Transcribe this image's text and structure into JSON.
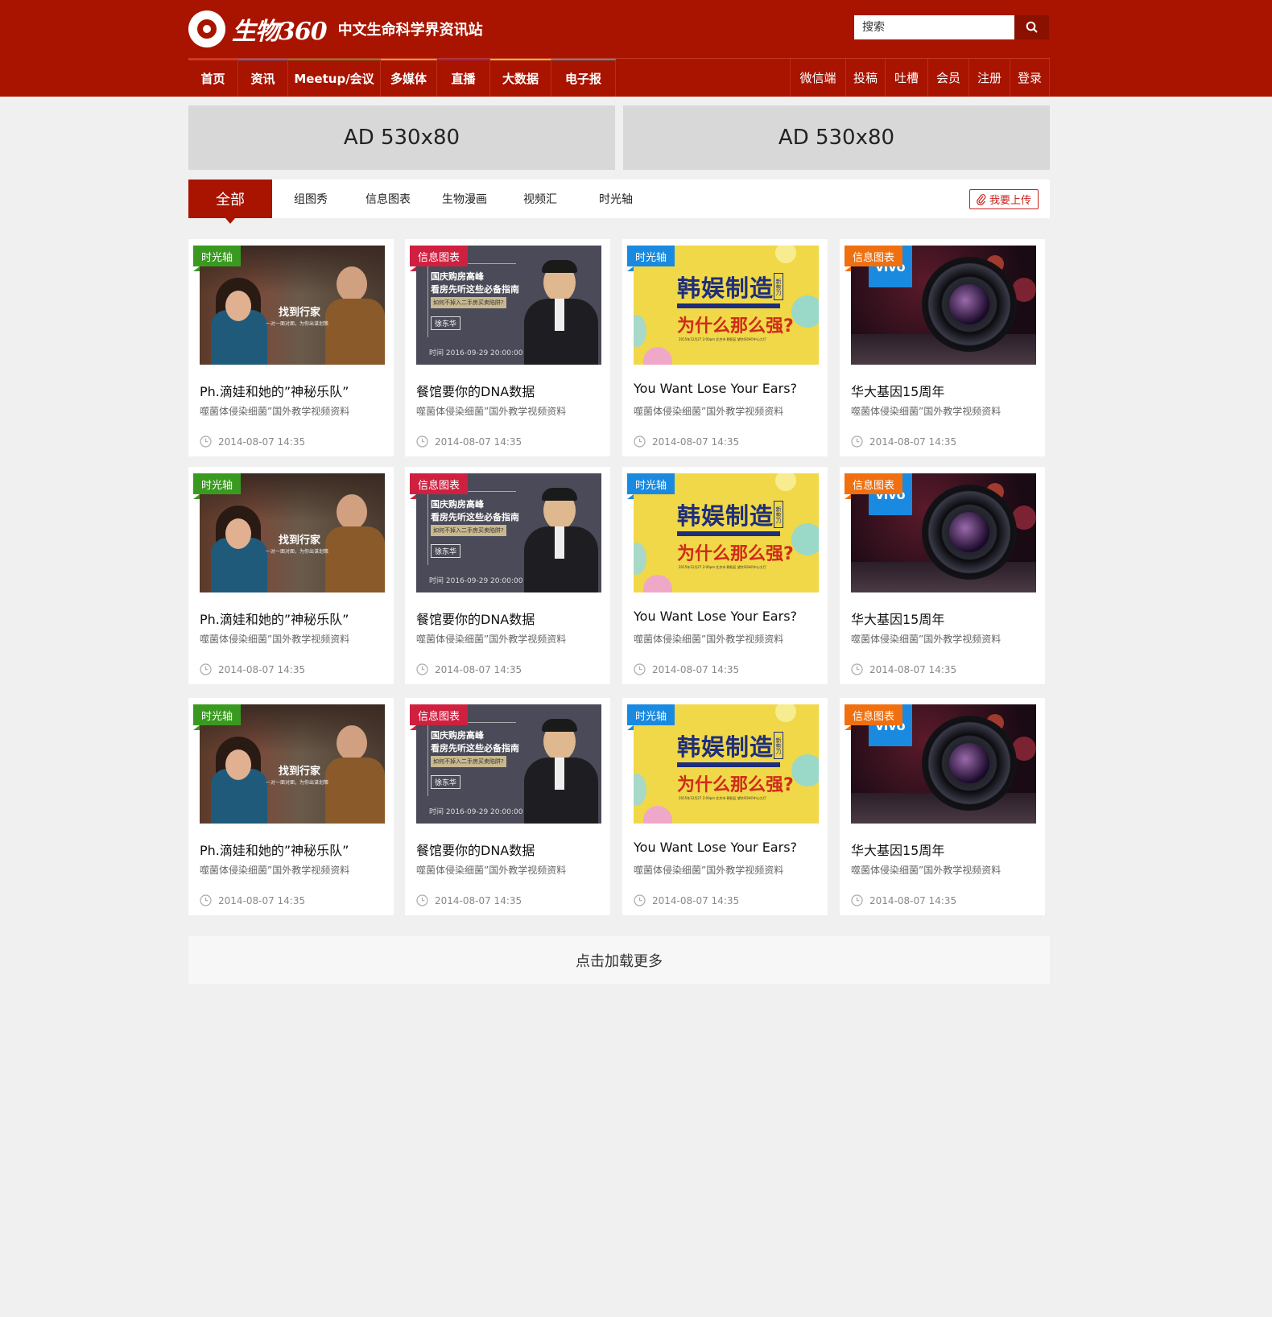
{
  "site": {
    "logo_text": "生物360",
    "slogan": "中文生命科学界资讯站"
  },
  "search": {
    "placeholder": "搜索"
  },
  "nav": {
    "left": [
      {
        "label": "首页",
        "accent": "#e83020"
      },
      {
        "label": "资讯",
        "accent": "#2a7de0"
      },
      {
        "label": "Meetup/会议",
        "accent": "#3aa040"
      },
      {
        "label": "多媒体",
        "accent": "#e8a020"
      },
      {
        "label": "直播",
        "accent": "#7a2aa0"
      },
      {
        "label": "大数据",
        "accent": "#e8c020"
      },
      {
        "label": "电子报",
        "accent": "#20a0c0"
      }
    ],
    "right": [
      {
        "label": "微信端"
      },
      {
        "label": "投稿"
      },
      {
        "label": "吐槽"
      },
      {
        "label": "会员"
      },
      {
        "label": "注册"
      },
      {
        "label": "登录"
      }
    ]
  },
  "ads": [
    {
      "label": "AD 530x80"
    },
    {
      "label": "AD 530x80"
    }
  ],
  "filter": {
    "tabs": [
      {
        "label": "全部"
      },
      {
        "label": "组图秀"
      },
      {
        "label": "信息图表"
      },
      {
        "label": "生物漫画"
      },
      {
        "label": "视频汇"
      },
      {
        "label": "时光轴"
      }
    ],
    "upload_label": "我要上传"
  },
  "card_types": [
    {
      "badge": "时光轴",
      "badge_color": "#3a9a20",
      "title": "Ph.滴娃和她的”神秘乐队”",
      "desc": "噬菌体侵染细菌”国外教学视频资料",
      "time": "2014-08-07 14:35",
      "thumb": {
        "caption": "找到行家",
        "subcaption": "一对一面对面，为你出谋划策"
      }
    },
    {
      "badge": "信息图表",
      "badge_color": "#d02040",
      "title": "餐馆要你的DNA数据",
      "desc": "噬菌体侵染细菌”国外教学视频资料",
      "time": "2014-08-07 14:35",
      "thumb": {
        "line1": "国庆购房高峰",
        "line2": "看房先听这些必备指南",
        "line3": "如何不掉入二手房买卖陷阱?",
        "name": "徐东华",
        "date": "时间 2016-09-29 20:00:00"
      }
    },
    {
      "badge": "时光轴",
      "badge_color": "#1a8ae0",
      "title": "You Want Lose Your Ears?",
      "desc": "噬菌体侵染细菌”国外教学视频资料",
      "time": "2014-08-07 14:35",
      "thumb": {
        "big1": "韩娱制造",
        "big2": "为什么那么强?",
        "side": "新势力",
        "small": "2015年12月27 2:00pm 北京市 朝阳区 望京SOHO中心大厅"
      }
    },
    {
      "badge": "信息图表",
      "badge_color": "#f07010",
      "title": "华大基因15周年",
      "desc": "噬菌体侵染细菌”国外教学视频资料",
      "time": "2014-08-07 14:35",
      "thumb": {
        "brand": "vivo"
      }
    }
  ],
  "load_more": "点击加载更多"
}
